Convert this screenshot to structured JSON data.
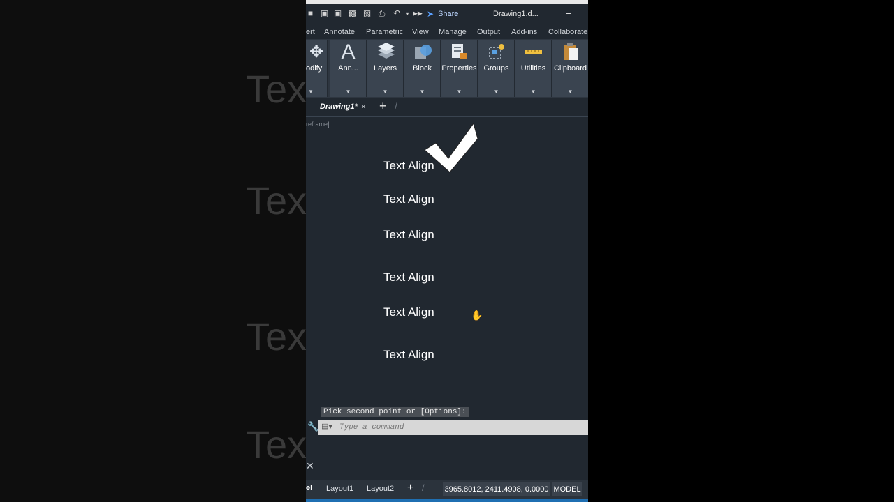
{
  "background": {
    "ghost_text": "Tex"
  },
  "quick_access": {
    "share_label": "Share",
    "document_title": "Drawing1.d...",
    "minimize_label": "–"
  },
  "ribbon_tabs": [
    "ert",
    "Annotate",
    "Parametric",
    "View",
    "Manage",
    "Output",
    "Add-ins",
    "Collaborate"
  ],
  "ribbon_panels": [
    {
      "label": "odify",
      "icon": "move-icon"
    },
    {
      "label": "Ann...",
      "icon": "annotation-text-icon"
    },
    {
      "label": "Layers",
      "icon": "layers-icon"
    },
    {
      "label": "Block",
      "icon": "block-icon"
    },
    {
      "label": "Properties",
      "icon": "properties-icon"
    },
    {
      "label": "Groups",
      "icon": "groups-icon"
    },
    {
      "label": "Utilities",
      "icon": "utilities-icon"
    },
    {
      "label": "Clipboard",
      "icon": "clipboard-icon"
    }
  ],
  "document_tab": {
    "label": "Drawing1*",
    "close_label": "×",
    "add_label": "+"
  },
  "viewport_label": "reframe]",
  "drawing_texts": [
    "Text Align",
    "Text Align",
    "Text Align",
    "Text Align",
    "Text Align",
    "Text Align"
  ],
  "command_line": {
    "prompt": "Pick second point or [Options]:",
    "placeholder": "Type a command"
  },
  "status_bar": {
    "model_tab": "el",
    "layout1": "Layout1",
    "layout2": "Layout2",
    "add_label": "+",
    "coordinates": "3965.8012, 2411.4908, 0.0000",
    "model_button": "MODEL"
  },
  "colors": {
    "app_background": "#212830",
    "ribbon_panel": "#3a4450",
    "command_bar": "#d7d7d7",
    "accent": "#1f6fb2"
  }
}
